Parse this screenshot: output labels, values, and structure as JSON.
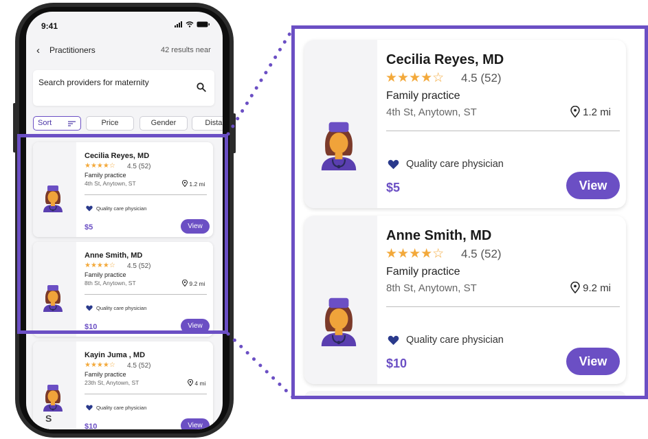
{
  "status_bar": {
    "time": "9:41"
  },
  "nav": {
    "back_icon": "chevron-left-icon",
    "title": "Practitioners",
    "results": "42 results near"
  },
  "search": {
    "text": "Search providers for maternity",
    "icon": "search-icon"
  },
  "filters": [
    {
      "label": "Sort",
      "active": true
    },
    {
      "label": "Price"
    },
    {
      "label": "Gender"
    },
    {
      "label": "Distan"
    }
  ],
  "cards": [
    {
      "name": "Cecilia Reyes, MD",
      "stars": "★★★★☆",
      "rating": "4.5 (52)",
      "specialty": "Family practice",
      "address": "4th St, Anytown, ST",
      "distance": "1.2 mi",
      "quality": "Quality care physician",
      "price": "$5",
      "view_label": "View"
    },
    {
      "name": "Anne Smith, MD",
      "stars": "★★★★☆",
      "rating": "4.5 (52)",
      "specialty": "Family practice",
      "address": "8th St, Anytown, ST",
      "distance": "9.2 mi",
      "quality": "Quality care physician",
      "price": "$10",
      "view_label": "View"
    },
    {
      "name": "Kayin Juma , MD",
      "stars": "★★★★☆",
      "rating": "4.5 (52)",
      "specialty": "Family practice",
      "address": "23th St, Anytown, ST",
      "distance": "4 mi",
      "quality": "Quality care physician",
      "price": "$10",
      "view_label": "View"
    }
  ],
  "home_glyph": "S",
  "colors": {
    "accent": "#6b4fc4",
    "star": "#f3a93b",
    "heart": "#2a3a8c",
    "avatar_skin": "#f0a33a"
  }
}
